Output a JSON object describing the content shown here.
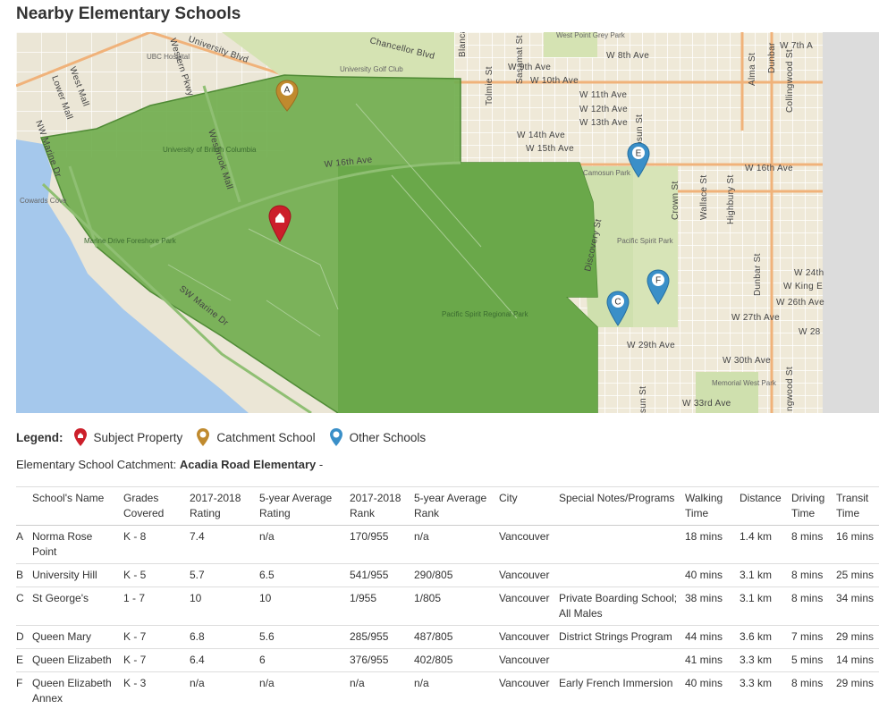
{
  "title": "Nearby Elementary Schools",
  "map": {
    "streets": [
      "University Blvd",
      "Chancellor Blvd",
      "W 7th A",
      "W 8th Ave",
      "W 9th Ave",
      "W 10th Ave",
      "W 11th Ave",
      "W 12th Ave",
      "W 13th Ave",
      "W 14th Ave",
      "W 15th Ave",
      "W 16th Ave",
      "W 16th Ave",
      "W 24th",
      "W King E",
      "W 26th Ave",
      "W 27th Ave",
      "W 28",
      "W 29th Ave",
      "W 30th Ave",
      "W 33rd Ave",
      "Wesbrook Mall",
      "SW Marine Dr",
      "NW Marine Dr",
      "Lower Mall",
      "West Mall",
      "Tolmie St",
      "Sasamat St",
      "Camosun St",
      "Crown St",
      "Wallace St",
      "Highbury St",
      "Dunbar St",
      "Alma St",
      "Collingwood St",
      "Discovery St",
      "Blanca",
      "Dunbar",
      "ngwood St",
      "sun St",
      "Western Pkwy"
    ],
    "places": [
      "UBC Hospital",
      "University Golf Club",
      "University of British Columbia",
      "Cowards Cove",
      "Marine Drive Foreshore Park",
      "Pacific Spirit Regional Park",
      "Camosun Park",
      "Pacific Spirit Park",
      "West Point Grey Park",
      "Memorial West Park"
    ],
    "pins": [
      {
        "letter": "A",
        "type": "catchment"
      },
      {
        "letter": "C",
        "type": "other"
      },
      {
        "letter": "E",
        "type": "other"
      },
      {
        "letter": "F",
        "type": "other"
      },
      {
        "letter": "",
        "type": "subject"
      }
    ],
    "colors": {
      "catchment_area": "#71ae4f",
      "park": "#cfe0ae",
      "water": "#a5c8ec",
      "subject_pin": "#cc1f2a",
      "catchment_pin": "#c08a2e",
      "other_pin": "#3a8fc8"
    }
  },
  "legend": {
    "title": "Legend:",
    "items": [
      {
        "label": "Subject Property",
        "icon": "subject-pin-icon",
        "color": "#cc1f2a"
      },
      {
        "label": "Catchment School",
        "icon": "catchment-pin-icon",
        "color": "#c08a2e"
      },
      {
        "label": "Other Schools",
        "icon": "school-pin-icon",
        "color": "#3a8fc8"
      }
    ]
  },
  "catchment": {
    "label": "Elementary School Catchment:",
    "school": "Acadia Road Elementary",
    "suffix": "-"
  },
  "table": {
    "headers": [
      "",
      "School's Name",
      "Grades Covered",
      "2017-2018 Rating",
      "5-year Average Rating",
      "2017-2018 Rank",
      "5-year Average Rank",
      "City",
      "Special Notes/Programs",
      "Walking Time",
      "Distance",
      "Driving Time",
      "Transit Time"
    ],
    "rows": [
      [
        "A",
        "Norma Rose Point",
        "K - 8",
        "7.4",
        "n/a",
        "170/955",
        "n/a",
        "Vancouver",
        "",
        "18 mins",
        "1.4 km",
        "8 mins",
        "16 mins"
      ],
      [
        "B",
        "University Hill",
        "K - 5",
        "5.7",
        "6.5",
        "541/955",
        "290/805",
        "Vancouver",
        "",
        "40 mins",
        "3.1 km",
        "8 mins",
        "25 mins"
      ],
      [
        "C",
        "St George's",
        "1 - 7",
        "10",
        "10",
        "1/955",
        "1/805",
        "Vancouver",
        "Private Boarding School; All Males",
        "38 mins",
        "3.1 km",
        "8 mins",
        "34 mins"
      ],
      [
        "D",
        "Queen Mary",
        "K - 7",
        "6.8",
        "5.6",
        "285/955",
        "487/805",
        "Vancouver",
        "District Strings Program",
        "44 mins",
        "3.6 km",
        "7 mins",
        "29 mins"
      ],
      [
        "E",
        "Queen Elizabeth",
        "K - 7",
        "6.4",
        "6",
        "376/955",
        "402/805",
        "Vancouver",
        "",
        "41 mins",
        "3.3 km",
        "5 mins",
        "14 mins"
      ],
      [
        "F",
        "Queen Elizabeth Annex",
        "K - 3",
        "n/a",
        "n/a",
        "n/a",
        "n/a",
        "Vancouver",
        "Early French Immersion",
        "40 mins",
        "3.3 km",
        "8 mins",
        "29 mins"
      ]
    ]
  }
}
